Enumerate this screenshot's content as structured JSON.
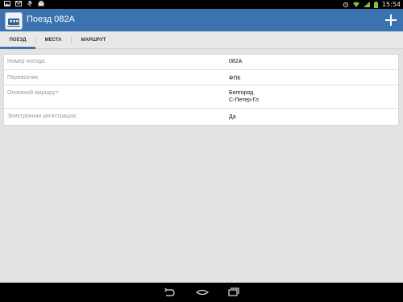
{
  "status_bar": {
    "time": "15:54",
    "left_icons": [
      "image-icon",
      "mail-icon",
      "usb-icon",
      "briefcase-icon"
    ],
    "right_icons": [
      "alarm-icon",
      "wifi-icon",
      "signal-icon",
      "battery-icon"
    ]
  },
  "action_bar": {
    "title": "Поезд 082А",
    "add_icon": "plus-icon",
    "background": "#3b73b0"
  },
  "tabs": [
    {
      "label": "ПОЕЗД",
      "active": true
    },
    {
      "label": "МЕСТА",
      "active": false
    },
    {
      "label": "МАРШРУТ",
      "active": false
    }
  ],
  "details": [
    {
      "label": "Номер поезда:",
      "value": [
        "082А"
      ]
    },
    {
      "label": "Перевозчик:",
      "value": [
        "ФПК"
      ]
    },
    {
      "label": "Основной маршрут:",
      "value": [
        "Белгород",
        "С-Петер-Гл"
      ]
    },
    {
      "label": "Электронная регистрация:",
      "value": [
        "Да"
      ]
    }
  ],
  "nav_bar": {
    "icons": [
      "back-icon",
      "home-icon",
      "recent-apps-icon"
    ]
  }
}
